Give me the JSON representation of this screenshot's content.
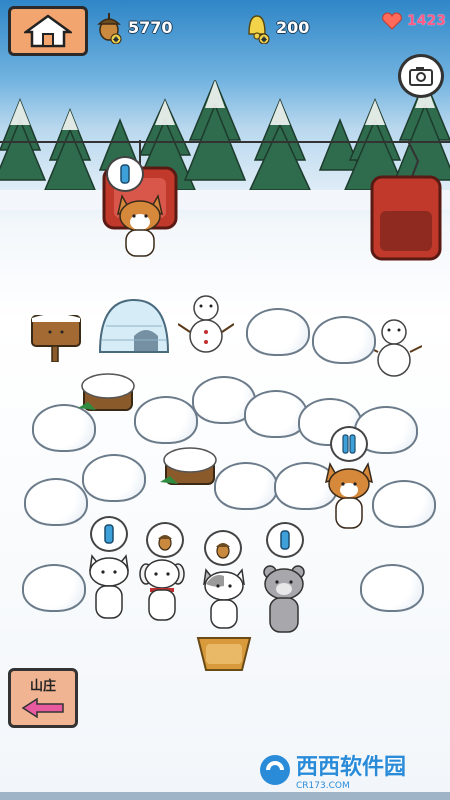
{
  "hud": {
    "acorns": "5770",
    "bells": "200",
    "hearts": "1423"
  },
  "nav": {
    "back_label": "山庄"
  },
  "watermark": {
    "main": "西西软件园",
    "sub": "CR173.COM"
  },
  "icons": {
    "home": "home-icon",
    "acorn": "acorn-icon",
    "bell": "bell-icon",
    "camera": "camera-icon",
    "arrow_left": "arrow-left-icon"
  },
  "colors": {
    "home_button": "#f3a56f",
    "back_button": "#f1b493",
    "sky": "#2f86c7",
    "tree": "#2e6b4a",
    "lift_chair": "#c0392b"
  }
}
